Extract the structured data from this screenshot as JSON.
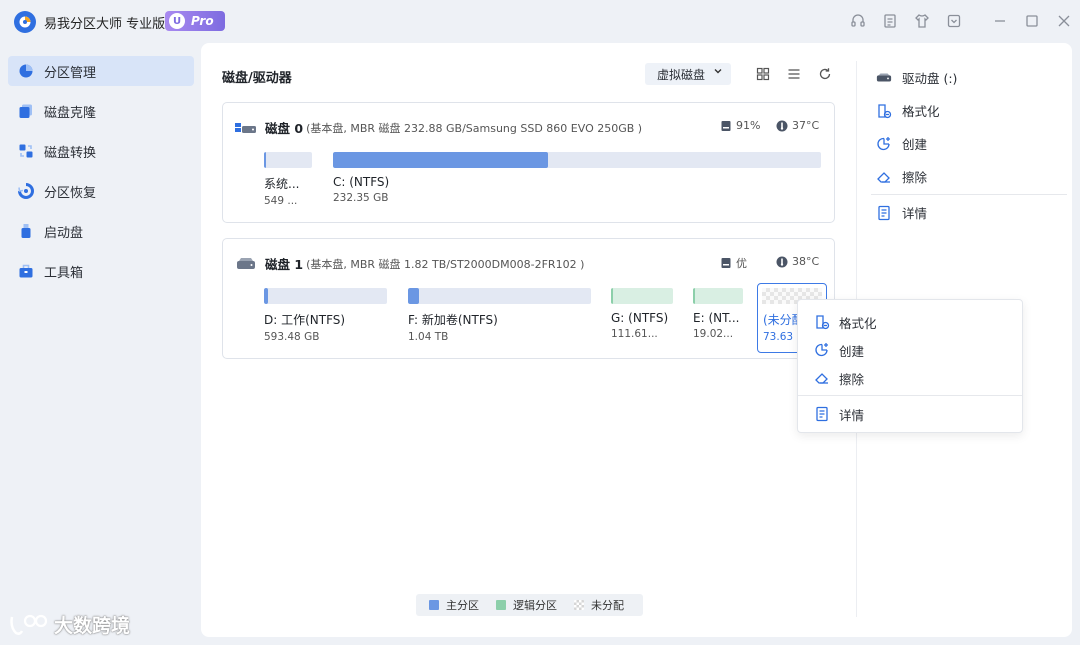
{
  "app": {
    "title": "易我分区大师 专业版",
    "badge_u": "U",
    "badge_pro": "Pro"
  },
  "titlebar_icons": [
    "headset-icon",
    "notes-icon",
    "shirt-icon",
    "download-icon",
    "minimize-icon",
    "maximize-icon",
    "close-icon"
  ],
  "sidebar": {
    "items": [
      {
        "label": "分区管理",
        "icon": "pie-chart-icon",
        "active": true
      },
      {
        "label": "磁盘克隆",
        "icon": "clone-icon",
        "active": false
      },
      {
        "label": "磁盘转换",
        "icon": "convert-icon",
        "active": false
      },
      {
        "label": "分区恢复",
        "icon": "recover-icon",
        "active": false
      },
      {
        "label": "启动盘",
        "icon": "usb-icon",
        "active": false
      },
      {
        "label": "工具箱",
        "icon": "toolbox-icon",
        "active": false
      }
    ]
  },
  "main": {
    "title": "磁盘/驱动器",
    "virtual_disk_label": "虚拟磁盘",
    "disks": [
      {
        "name": "磁盘 0",
        "info": "(基本盘, MBR 磁盘 232.88 GB/Samsung SSD 860 EVO 250GB )",
        "health": "91%",
        "temp": "37°C",
        "partitions": [
          {
            "name": "系统...",
            "size": "549 ...",
            "type": "primary",
            "used": 0.05
          },
          {
            "name": "C: (NTFS)",
            "size": "232.35 GB",
            "type": "primary",
            "used": 0.44
          }
        ]
      },
      {
        "name": "磁盘 1",
        "info": "(基本盘, MBR 磁盘 1.82 TB/ST2000DM008-2FR102 )",
        "health": "优",
        "temp": "38°C",
        "partitions": [
          {
            "name": "D: 工作(NTFS)",
            "size": "593.48 GB",
            "type": "primary",
            "used": 0.02
          },
          {
            "name": "F: 新加卷(NTFS)",
            "size": "1.04 TB",
            "type": "primary",
            "used": 0.06
          },
          {
            "name": "G: (NTFS)",
            "size": "111.61...",
            "type": "logical",
            "used": 0.04
          },
          {
            "name": "E: (NT...",
            "size": "19.02...",
            "type": "logical",
            "used": 0.04
          },
          {
            "name": "(未分配",
            "size": "73.63 ...",
            "type": "unallocated",
            "used": 0
          }
        ]
      }
    ],
    "legend": [
      {
        "label": "主分区",
        "color": "#6b97e3"
      },
      {
        "label": "逻辑分区",
        "color": "#8ccfaa"
      },
      {
        "label": "未分配",
        "color": "checker"
      }
    ]
  },
  "right_panel": {
    "header": "驱动盘 (:)",
    "actions": [
      "格式化",
      "创建",
      "擦除"
    ],
    "details": "详情"
  },
  "context_menu": {
    "items": [
      "格式化",
      "创建",
      "擦除"
    ],
    "details": "详情"
  },
  "watermark": "大数跨境",
  "colors": {
    "accent": "#2f6fe0",
    "primary_partition": "#6b97e3",
    "logical_partition": "#8ccfaa",
    "active_nav_bg": "#d8e4f8"
  }
}
